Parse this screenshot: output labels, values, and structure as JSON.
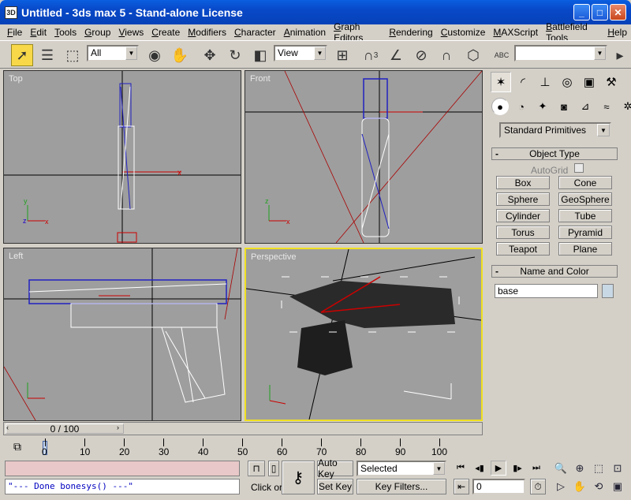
{
  "window": {
    "title": "Untitled - 3ds max 5 - Stand-alone License",
    "app_icon_text": "3D",
    "buttons": {
      "minimize": "_",
      "maximize": "□",
      "close": "✕"
    }
  },
  "menu": [
    "File",
    "Edit",
    "Tools",
    "Group",
    "Views",
    "Create",
    "Modifiers",
    "Character",
    "Animation",
    "Graph Editors",
    "Rendering",
    "Customize",
    "MAXScript",
    "Battlefield Tools",
    "Help"
  ],
  "toolbar": {
    "filter_value": "All",
    "ref_coord_value": "View",
    "snap_label_3": "3",
    "percent_label": "%",
    "named_sel_value": "",
    "icons": [
      "select-arrow",
      "select-by-name",
      "region-select",
      "filter-dropdown",
      "select-move",
      "select-rotate",
      "select-scale",
      "ref-coord",
      "pivot",
      "mirror",
      "snap",
      "angle-snap",
      "percent-snap",
      "spinner-snap",
      "named-selection-sets"
    ]
  },
  "viewports": {
    "top": "Top",
    "front": "Front",
    "left": "Left",
    "perspective": "Perspective"
  },
  "command_panel": {
    "tabs": [
      "create-icon",
      "modify-icon",
      "hierarchy-icon",
      "motion-icon",
      "display-icon",
      "utilities-icon"
    ],
    "category": "Standard Primitives",
    "object_type_header": "Object Type",
    "autogrid": "AutoGrid",
    "primitives": [
      "Box",
      "Cone",
      "Sphere",
      "GeoSphere",
      "Cylinder",
      "Tube",
      "Torus",
      "Pyramid",
      "Teapot",
      "Plane"
    ],
    "name_color_header": "Name and Color",
    "name_value": "base",
    "rollout_sign": "-",
    "name_color_swatch": "#c8d8e4"
  },
  "timeline": {
    "slider_label": "0 / 100",
    "ticks": [
      "0",
      "10",
      "20",
      "30",
      "40",
      "50",
      "60",
      "70",
      "80",
      "90",
      "100"
    ]
  },
  "bottom": {
    "maxscript_output": "\"--- Done bonesys() ---\"",
    "status_text": "Click or",
    "auto_key": "Auto Key",
    "set_key": "Set Key",
    "selected_value": "Selected",
    "key_filters": "Key Filters...",
    "frame_value": "0"
  }
}
